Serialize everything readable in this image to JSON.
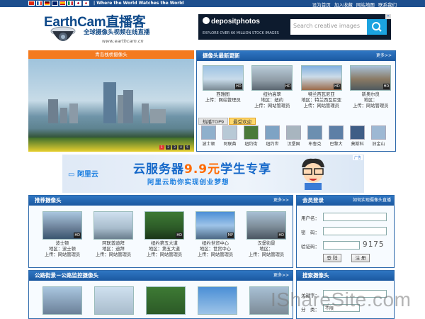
{
  "topbar": {
    "flags": [
      "cn",
      "fr",
      "de",
      "uk",
      "es",
      "it",
      "jp",
      "kr"
    ],
    "tagline": "| Where the World Watches the World",
    "links": [
      "设为首页",
      "加入收藏",
      "网站地图",
      "联系我们"
    ]
  },
  "header": {
    "logo_title": "EarthCam直播客",
    "logo_sub": "全球摄像头视频在线直播",
    "logo_url": "www.earthcam.cn"
  },
  "ad_top": {
    "brand": "depositphotos",
    "tagline": "EXPLORE OVER 66 MILLION STOCK IMAGES",
    "search_placeholder": "Search creative images",
    "close": "✕"
  },
  "banner": {
    "title": "青岛栈桥摄像头",
    "dots": [
      "1",
      "2",
      "3",
      "4",
      "5"
    ],
    "active_dot": 1
  },
  "latest": {
    "title": "摄像头最新更新",
    "more": "更多>>",
    "cams": [
      {
        "name": "西雅图",
        "area": "",
        "uploader": "上传：网站管理员",
        "hd": "HD"
      },
      {
        "name": "纽约高翠",
        "area": "地区：纽约",
        "uploader": "上传：网站管理员",
        "hd": "HD"
      },
      {
        "name": "特兰西瓦尼亚",
        "area": "地区：特兰西瓦尼亚",
        "uploader": "上传：网站管理员",
        "hd": "HD"
      },
      {
        "name": "新奥尔良",
        "area": "地区：",
        "uploader": "上传：网站管理员",
        "hd": "HD"
      }
    ],
    "tabs": [
      "热播TOP9",
      "最受欢迎"
    ],
    "active_tab": 1,
    "top9": [
      "波士顿",
      "阿联酋",
      "纽约街",
      "纽约世",
      "汉堡国",
      "布鲁克",
      "巴黎大",
      "莫斯科",
      "旧金山"
    ]
  },
  "ad_mid": {
    "brand": "阿里云",
    "headline_a": "云服务器",
    "headline_b": "9.9元",
    "headline_c": "学生专享",
    "subline": "阿里云助你实现创业梦想",
    "ad_label": "广告"
  },
  "recommended": {
    "title": "推荐摄像头",
    "more": "更多>>",
    "cams": [
      {
        "name": "波士顿",
        "area": "地区：波士顿",
        "uploader": "上传：网站管理员"
      },
      {
        "name": "阿联酋迪拜",
        "area": "地区：迪拜",
        "uploader": "上传：网站管理员"
      },
      {
        "name": "纽约第五大道",
        "area": "地区：第五大道",
        "uploader": "上传：网站管理员"
      },
      {
        "name": "纽约世贸中心",
        "area": "地区：世贸中心",
        "uploader": "上传：网站管理员"
      },
      {
        "name": "汉堡街景",
        "area": "地区：",
        "uploader": "上传：网站管理员"
      }
    ],
    "badges": [
      "HD",
      "",
      "HD",
      "MP",
      "HD"
    ]
  },
  "login": {
    "title": "会员登录",
    "help": "如何实现摄像头直播",
    "username_label": "用户名：",
    "password_label": "密　码：",
    "captcha_label": "验证码：",
    "captcha_value": "9175",
    "login_button": "登 陆",
    "register_button": "注 册"
  },
  "road": {
    "title": "公路街景－公路监控摄像头",
    "more": "更多>>"
  },
  "search": {
    "title": "搜索摄像头",
    "keyword_label": "关键字：",
    "category_label": "分　类：",
    "category_value": "不限"
  },
  "watermark": "IShareSite.com"
}
